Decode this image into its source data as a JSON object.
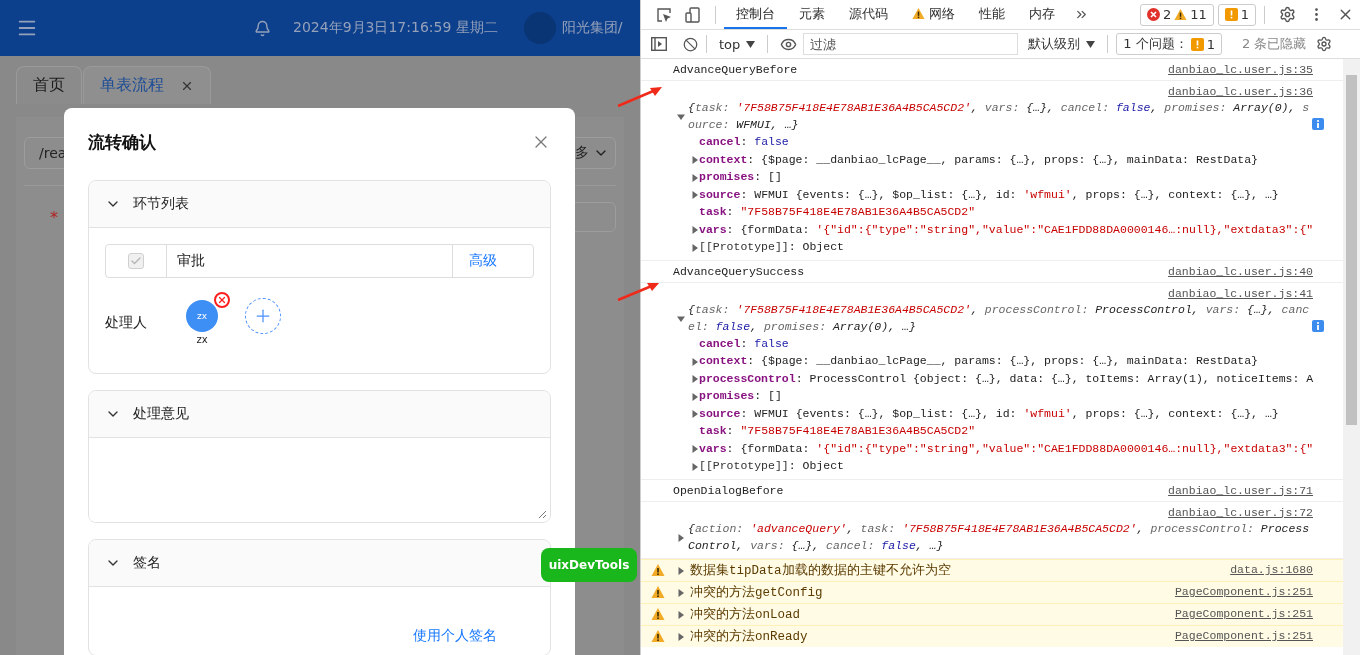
{
  "app": {
    "header": {
      "datetime": "2024年9月3日17:16:59 星期二",
      "org": "阳光集团/"
    },
    "tabs": [
      {
        "label": "首页",
        "selected": false,
        "closable": false
      },
      {
        "label": "单表流程",
        "selected": true,
        "closable": true
      }
    ],
    "background_form": {
      "path_value": "/rea",
      "more_label": "多",
      "required_mark": "*"
    }
  },
  "dialog": {
    "title": "流转确认",
    "sections": [
      {
        "kind": "steps",
        "title": "环节列表",
        "expanded": true,
        "steps": [
          {
            "name": "审批",
            "checked": true,
            "disabled": true,
            "action": "高级"
          }
        ],
        "handler_label": "处理人",
        "handlers": [
          {
            "initials": "zx",
            "name": "zx"
          }
        ]
      },
      {
        "kind": "comment",
        "title": "处理意见",
        "expanded": true
      },
      {
        "kind": "signature",
        "title": "签名",
        "expanded": true,
        "link": "使用个人签名"
      }
    ]
  },
  "dev_tools_badge": "uixDevTools",
  "devtools": {
    "tabs": [
      {
        "label": "控制台",
        "selected": true,
        "warning": false
      },
      {
        "label": "元素",
        "selected": false,
        "warning": false
      },
      {
        "label": "源代码",
        "selected": false,
        "warning": false
      },
      {
        "label": "网络",
        "selected": false,
        "warning": true
      },
      {
        "label": "性能",
        "selected": false,
        "warning": false
      },
      {
        "label": "内存",
        "selected": false,
        "warning": false
      }
    ],
    "counters": {
      "errors": "2",
      "warnings": "11",
      "issues": "1"
    },
    "console_toolbar": {
      "context": "top",
      "filter_placeholder": "过滤",
      "level": "默认级别",
      "issues_label": "1 个问题：",
      "issues_count": "1",
      "hidden": "2 条已隐藏"
    },
    "console": [
      {
        "kind": "log",
        "text": "AdvanceQueryBefore",
        "source": "danbiao_lc.user.js:35"
      },
      {
        "kind": "object",
        "source": "danbiao_lc.user.js:36",
        "expanded": true,
        "info": true,
        "summary": [
          {
            "kind": "plain",
            "text": "{"
          },
          {
            "kind": "key",
            "text": "task: "
          },
          {
            "kind": "str",
            "text": "'7F58B75F418E4E78AB1E36A4B5CA5CD2'"
          },
          {
            "kind": "plain",
            "text": ", "
          },
          {
            "kind": "key",
            "text": "vars: "
          },
          {
            "kind": "plain",
            "text": "{…}"
          },
          {
            "kind": "plain",
            "text": ", "
          },
          {
            "kind": "key",
            "text": "cancel: "
          },
          {
            "kind": "bool",
            "text": "false"
          },
          {
            "kind": "plain",
            "text": ", "
          },
          {
            "kind": "key",
            "text": "promises: "
          },
          {
            "kind": "plain",
            "text": "Array(0)"
          },
          {
            "kind": "plain",
            "text": ", "
          },
          {
            "kind": "key",
            "text": "source: "
          },
          {
            "kind": "plain",
            "text": "WFMUI"
          },
          {
            "kind": "plain",
            "text": ", …}"
          }
        ],
        "props": [
          {
            "key": "cancel",
            "expandable": false,
            "internal": false,
            "value": [
              {
                "kind": "plain",
                "text": ": "
              },
              {
                "kind": "bool",
                "text": "false"
              }
            ]
          },
          {
            "key": "context",
            "expandable": true,
            "internal": false,
            "value": [
              {
                "kind": "plain",
                "text": ": {$page: __danbiao_lcPage__, params: {…}, props: {…}, mainData: RestData}"
              }
            ]
          },
          {
            "key": "promises",
            "expandable": true,
            "internal": false,
            "value": [
              {
                "kind": "plain",
                "text": ": []"
              }
            ]
          },
          {
            "key": "source",
            "expandable": true,
            "internal": false,
            "value": [
              {
                "kind": "plain",
                "text": ": WFMUI {events: {…}, $op_list: {…}, id: "
              },
              {
                "kind": "str",
                "text": "'wfmui'"
              },
              {
                "kind": "plain",
                "text": ", props: {…}, context: {…}, …}"
              }
            ]
          },
          {
            "key": "task",
            "expandable": false,
            "internal": false,
            "value": [
              {
                "kind": "plain",
                "text": ": "
              },
              {
                "kind": "str",
                "text": "\"7F58B75F418E4E78AB1E36A4B5CA5CD2\""
              }
            ]
          },
          {
            "key": "vars",
            "expandable": true,
            "internal": false,
            "value": [
              {
                "kind": "plain",
                "text": ": {formData: "
              },
              {
                "kind": "str",
                "text": "'{\"id\":{\"type\":\"string\",\"value\":\"CAE1FDD88DA0000146…:null},\"extdata3\":{\""
              }
            ]
          },
          {
            "key": "[[Prototype]]",
            "expandable": true,
            "internal": true,
            "value": [
              {
                "kind": "plain",
                "text": ": Object"
              }
            ]
          }
        ]
      },
      {
        "kind": "log",
        "text": "AdvanceQuerySuccess",
        "source": "danbiao_lc.user.js:40"
      },
      {
        "kind": "object",
        "source": "danbiao_lc.user.js:41",
        "expanded": true,
        "info": true,
        "summary": [
          {
            "kind": "plain",
            "text": "{"
          },
          {
            "kind": "key",
            "text": "task: "
          },
          {
            "kind": "str",
            "text": "'7F58B75F418E4E78AB1E36A4B5CA5CD2'"
          },
          {
            "kind": "plain",
            "text": ", "
          },
          {
            "kind": "key",
            "text": "processControl: "
          },
          {
            "kind": "plain",
            "text": "ProcessControl"
          },
          {
            "kind": "plain",
            "text": ", "
          },
          {
            "kind": "key",
            "text": "vars: "
          },
          {
            "kind": "plain",
            "text": "{…}"
          },
          {
            "kind": "plain",
            "text": ", "
          },
          {
            "kind": "key",
            "text": "cancel: "
          },
          {
            "kind": "bool",
            "text": "false"
          },
          {
            "kind": "plain",
            "text": ", "
          },
          {
            "kind": "key",
            "text": "promises: "
          },
          {
            "kind": "plain",
            "text": "Array(0)"
          },
          {
            "kind": "plain",
            "text": ", …}"
          }
        ],
        "props": [
          {
            "key": "cancel",
            "expandable": false,
            "internal": false,
            "value": [
              {
                "kind": "plain",
                "text": ": "
              },
              {
                "kind": "bool",
                "text": "false"
              }
            ]
          },
          {
            "key": "context",
            "expandable": true,
            "internal": false,
            "value": [
              {
                "kind": "plain",
                "text": ": {$page: __danbiao_lcPage__, params: {…}, props: {…}, mainData: RestData}"
              }
            ]
          },
          {
            "key": "processControl",
            "expandable": true,
            "internal": false,
            "value": [
              {
                "kind": "plain",
                "text": ": ProcessControl {object: {…}, data: {…}, toItems: Array(1), noticeItems: A"
              }
            ]
          },
          {
            "key": "promises",
            "expandable": true,
            "internal": false,
            "value": [
              {
                "kind": "plain",
                "text": ": []"
              }
            ]
          },
          {
            "key": "source",
            "expandable": true,
            "internal": false,
            "value": [
              {
                "kind": "plain",
                "text": ": WFMUI {events: {…}, $op_list: {…}, id: "
              },
              {
                "kind": "str",
                "text": "'wfmui'"
              },
              {
                "kind": "plain",
                "text": ", props: {…}, context: {…}, …}"
              }
            ]
          },
          {
            "key": "task",
            "expandable": false,
            "internal": false,
            "value": [
              {
                "kind": "plain",
                "text": ": "
              },
              {
                "kind": "str",
                "text": "\"7F58B75F418E4E78AB1E36A4B5CA5CD2\""
              }
            ]
          },
          {
            "key": "vars",
            "expandable": true,
            "internal": false,
            "value": [
              {
                "kind": "plain",
                "text": ": {formData: "
              },
              {
                "kind": "str",
                "text": "'{\"id\":{\"type\":\"string\",\"value\":\"CAE1FDD88DA0000146…:null},\"extdata3\":{\""
              }
            ]
          },
          {
            "key": "[[Prototype]]",
            "expandable": true,
            "internal": true,
            "value": [
              {
                "kind": "plain",
                "text": ": Object"
              }
            ]
          }
        ]
      },
      {
        "kind": "log",
        "text": "OpenDialogBefore",
        "source": "danbiao_lc.user.js:71"
      },
      {
        "kind": "object",
        "source": "danbiao_lc.user.js:72",
        "expanded": false,
        "info": false,
        "summary": [
          {
            "kind": "plain",
            "text": "{"
          },
          {
            "kind": "key",
            "text": "action: "
          },
          {
            "kind": "str",
            "text": "'advanceQuery'"
          },
          {
            "kind": "plain",
            "text": ", "
          },
          {
            "kind": "key",
            "text": "task: "
          },
          {
            "kind": "str",
            "text": "'7F58B75F418E4E78AB1E36A4B5CA5CD2'"
          },
          {
            "kind": "plain",
            "text": ", "
          },
          {
            "kind": "key",
            "text": "processControl: "
          },
          {
            "kind": "plain",
            "text": "ProcessControl"
          },
          {
            "kind": "plain",
            "text": ", "
          },
          {
            "kind": "key",
            "text": "vars: "
          },
          {
            "kind": "plain",
            "text": "{…}"
          },
          {
            "kind": "plain",
            "text": ", "
          },
          {
            "kind": "key",
            "text": "cancel: "
          },
          {
            "kind": "bool",
            "text": "false"
          },
          {
            "kind": "plain",
            "text": ", …}"
          }
        ]
      },
      {
        "kind": "warn",
        "text": "数据集tipData加载的数据的主键不允许为空",
        "source": "data.js:1680"
      },
      {
        "kind": "warn",
        "text": "冲突的方法getConfig",
        "source": "PageComponent.js:251"
      },
      {
        "kind": "warn",
        "text": "冲突的方法onLoad",
        "source": "PageComponent.js:251"
      },
      {
        "kind": "warn",
        "text": "冲突的方法onReady",
        "source": "PageComponent.js:251"
      }
    ]
  }
}
